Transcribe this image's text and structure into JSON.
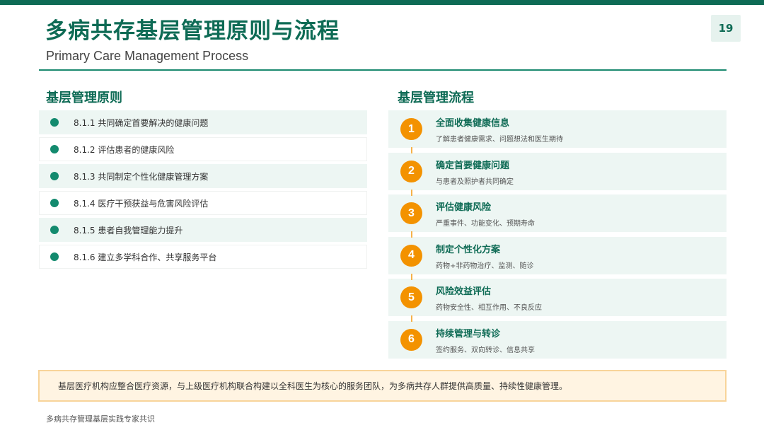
{
  "header": {
    "title": "多病共存基层管理原则与流程",
    "subtitle": "Primary Care Management Process",
    "page_number": "19"
  },
  "principles": {
    "title": "基层管理原则",
    "items": [
      "8.1.1 共同确定首要解决的健康问题",
      "8.1.2 评估患者的健康风险",
      "8.1.3 共同制定个性化健康管理方案",
      "8.1.4 医疗干预获益与危害风险评估",
      "8.1.5 患者自我管理能力提升",
      "8.1.6 建立多学科合作、共享服务平台"
    ]
  },
  "process": {
    "title": "基层管理流程",
    "steps": [
      {
        "num": "1",
        "title": "全面收集健康信息",
        "desc": "了解患者健康需求、问题想法和医生期待"
      },
      {
        "num": "2",
        "title": "确定首要健康问题",
        "desc": "与患者及照护者共同确定"
      },
      {
        "num": "3",
        "title": "评估健康风险",
        "desc": "严重事件、功能变化、预期寿命"
      },
      {
        "num": "4",
        "title": "制定个性化方案",
        "desc": "药物+非药物治疗、监测、随诊"
      },
      {
        "num": "5",
        "title": "风险效益评估",
        "desc": "药物安全性、相互作用、不良反应"
      },
      {
        "num": "6",
        "title": "持续管理与转诊",
        "desc": "签约服务、双向转诊、信息共享"
      }
    ]
  },
  "note": "基层医疗机构应整合医疗资源，与上级医疗机构联合构建以全科医生为核心的服务团队，为多病共存人群提供高质量、持续性健康管理。",
  "footer": "多病共存管理基层实践专家共识",
  "colors": {
    "brand_green": "#0e6b55",
    "accent_orange": "#f39200",
    "row_tint": "#edf6f3",
    "note_bg": "#fff4e2",
    "note_border": "#f8d49a"
  }
}
